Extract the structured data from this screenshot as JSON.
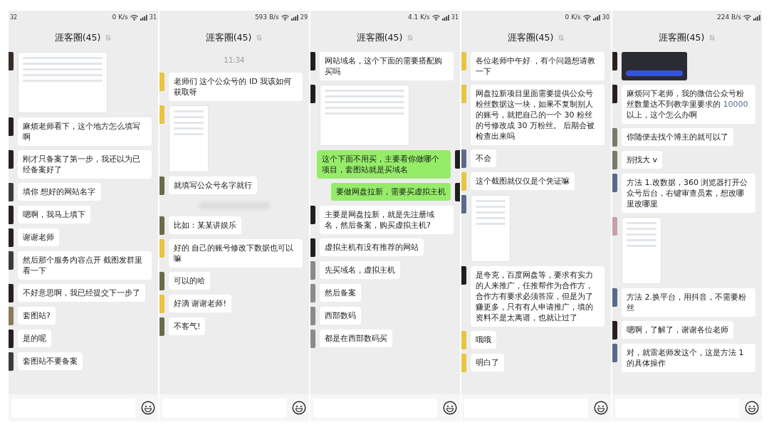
{
  "panels": [
    {
      "status": {
        "time": "32",
        "speed": "0 K/s",
        "battery": "31"
      },
      "title": "涯客圈(45)",
      "muted": true,
      "messages": [
        {
          "kind": "wideshot",
          "color": "#3a2a2a"
        },
        {
          "kind": "text",
          "mine": false,
          "color": "#2a1f1f",
          "text": "麻烦老师看下，这个地方怎么填写啊"
        },
        {
          "kind": "text",
          "mine": false,
          "color": "#2a1f1f",
          "text": "刚才只备案了第一步，我还以为已经备案好了"
        },
        {
          "kind": "text",
          "mine": false,
          "color": "#3b3b3b",
          "text": "填你 想好的网站名字"
        },
        {
          "kind": "text",
          "mine": false,
          "color": "#2a1f1f",
          "text": "嗯啊，我马上填下"
        },
        {
          "kind": "text",
          "mine": false,
          "color": "#2a1f1f",
          "text": "谢谢老师"
        },
        {
          "kind": "text",
          "mine": false,
          "color": "#3b3b3b",
          "text": "然后那个服务内容点开 截图发群里看一下"
        },
        {
          "kind": "text",
          "mine": false,
          "color": "#2a1f1f",
          "text": "不好意思啊，我已经提交下一步了"
        },
        {
          "kind": "text",
          "mine": false,
          "color": "#8a7a5a",
          "text": "套图站?"
        },
        {
          "kind": "text",
          "mine": false,
          "color": "#2a1f1f",
          "text": "是的呢"
        },
        {
          "kind": "text",
          "mine": false,
          "color": "#3b3b3b",
          "text": "套图站不要备案"
        }
      ]
    },
    {
      "status": {
        "speed": "593 B/s",
        "battery": "29"
      },
      "title": "涯客圈(45)",
      "muted": true,
      "messages": [
        {
          "kind": "time",
          "text": "11:34"
        },
        {
          "kind": "text",
          "mine": false,
          "color": "#e8c440",
          "text": "老师们 这个公众号的 ID 我该如何获取呀"
        },
        {
          "kind": "tallshot",
          "color": "#e8c440"
        },
        {
          "kind": "text",
          "mine": false,
          "color": "#6b6b4a",
          "text": "就填写公众号名字就行"
        },
        {
          "kind": "blurred"
        },
        {
          "kind": "text",
          "mine": false,
          "color": "#6b6b4a",
          "text": "比如：某某讲娱乐"
        },
        {
          "kind": "text",
          "mine": false,
          "color": "#e8c440",
          "text": "好的 自己的账号修改下数据也可以嘛"
        },
        {
          "kind": "text",
          "mine": false,
          "color": "#6b6b4a",
          "text": "可以的哈"
        },
        {
          "kind": "text",
          "mine": false,
          "color": "#e8c440",
          "text": "好滴 谢谢老师!"
        },
        {
          "kind": "text",
          "mine": false,
          "color": "#6b6b4a",
          "text": "不客气!"
        }
      ]
    },
    {
      "status": {
        "speed": "4.1 K/s",
        "battery": "31"
      },
      "title": "涯客圈(45)",
      "muted": true,
      "messages": [
        {
          "kind": "text",
          "mine": false,
          "color": "#1f1f1f",
          "text": "网站域名，这个下面的需要搭配购买吗"
        },
        {
          "kind": "wideshot",
          "color": "#1f1f1f"
        },
        {
          "kind": "text",
          "mine": true,
          "color": "#1f1f1f",
          "text": "这个下面不用买，主要看你做哪个项目，套图站就是买域名"
        },
        {
          "kind": "text",
          "mine": true,
          "color": "#1f1f1f",
          "text": "要做网盘拉新，需要买虚拟主机"
        },
        {
          "kind": "text",
          "mine": false,
          "color": "#1f1f1f",
          "text": "主要是网盘拉新，就是先注册域名，然后备案，购买虚拟主机?"
        },
        {
          "kind": "text",
          "mine": false,
          "color": "#1f1f1f",
          "text": "虚拟主机有没有推荐的网站"
        },
        {
          "kind": "text",
          "mine": false,
          "color": "#8a8a8a",
          "text": "先买域名，虚拟主机"
        },
        {
          "kind": "text",
          "mine": false,
          "color": "#8a8a8a",
          "text": "然后备案"
        },
        {
          "kind": "text",
          "mine": false,
          "color": "#8a8a8a",
          "text": "西部数码"
        },
        {
          "kind": "text",
          "mine": false,
          "color": "#8a8a8a",
          "text": "都是在西部数码买"
        }
      ]
    },
    {
      "status": {
        "speed": "0 K/s",
        "battery": "30"
      },
      "title": "涯客圈(45)",
      "muted": true,
      "messages": [
        {
          "kind": "text",
          "mine": false,
          "color": "#e8c440",
          "text": "各位老师中午好 ，有个问题想请教一下"
        },
        {
          "kind": "text",
          "mine": false,
          "color": "#e8c440",
          "text": "网盘拉新项目里面需要提供公众号粉丝数据这一块，如果不复制别人的账号，就把自己的一个 30 粉丝的号修改成 30 万粉丝。 后期会被检查出来吗"
        },
        {
          "kind": "text",
          "mine": false,
          "color": "#5a6a8a",
          "text": "不会"
        },
        {
          "kind": "text",
          "mine": false,
          "color": "#e8c440",
          "text": "这个截图就仅仅是个凭证嘛"
        },
        {
          "kind": "tallshot",
          "color": "#5a6a8a"
        },
        {
          "kind": "text",
          "mine": false,
          "color": "#1f1f1f",
          "text": "是夸克，百度网盘等，要求有实力的人来推广，任推帮作为合作方，合作方有要求必须答应，但是为了赚更多，只有有人申请推广，填的资料不是太离谱，也就让过了"
        },
        {
          "kind": "text",
          "mine": false,
          "color": "#e8c440",
          "text": "哦哦"
        },
        {
          "kind": "text",
          "mine": false,
          "color": "#e8c440",
          "text": "明白了"
        }
      ]
    },
    {
      "status": {
        "speed": "224 B/s"
      },
      "title": "涯客圈(45)",
      "muted": true,
      "messages": [
        {
          "kind": "banner",
          "color": "#2a1f1f"
        },
        {
          "kind": "text",
          "mine": false,
          "color": "#2a1f1f",
          "parts": [
            {
              "text": "麻烦问下老师，我的微信公众号粉丝数量达不到教学里要求的 ",
              "link": false
            },
            {
              "text": "10000",
              "link": true
            },
            {
              "text": "以上，这个怎么办啊",
              "link": false
            }
          ]
        },
        {
          "kind": "text",
          "mine": false,
          "color": "#7a7a6a",
          "text": "你随便去找个博主的就可以了"
        },
        {
          "kind": "text",
          "mine": false,
          "color": "#7a7a6a",
          "text": "别找大 v"
        },
        {
          "kind": "text",
          "mine": false,
          "color": "#5a6a8a",
          "text": "方法 1.改数据，360 浏览器打开公众号后台，右键审查员素，想改哪里改哪里"
        },
        {
          "kind": "tallshot",
          "color": "#c8a0a8"
        },
        {
          "kind": "text",
          "mine": false,
          "color": "#5a6a8a",
          "text": "方法 2.换平台，用抖音，不需要粉丝"
        },
        {
          "kind": "text",
          "mine": false,
          "color": "#2a1f1f",
          "text": "嗯啊，了解了，谢谢各位老师"
        },
        {
          "kind": "text",
          "mine": false,
          "color": "#5a6a8a",
          "text": "对，就雷老师发这个，这是方法 1 的具体操作"
        }
      ]
    }
  ]
}
